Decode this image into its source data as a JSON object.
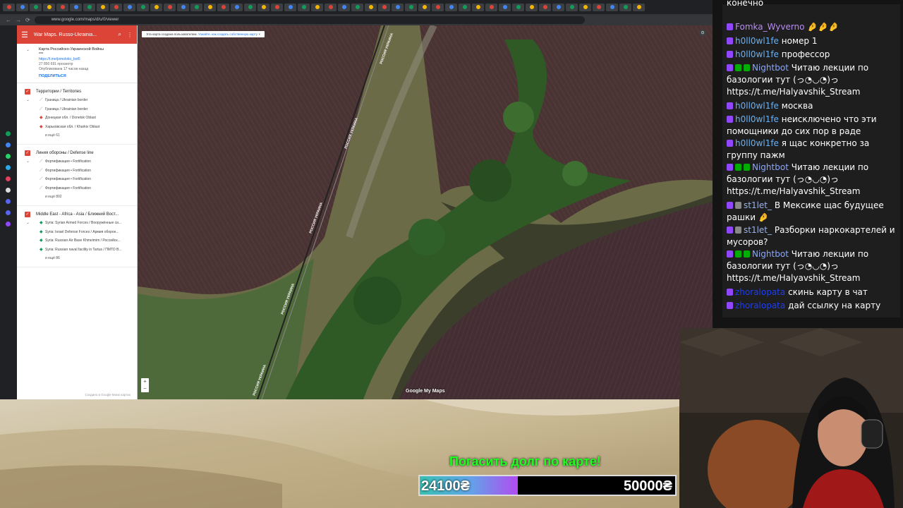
{
  "browser": {
    "url": "www.google.com/maps/d/u/0/viewer",
    "tab_colors": [
      "#db4437",
      "#4285f4",
      "#0f9d58",
      "#f4b400",
      "#db4437",
      "#4285f4",
      "#0f9d58",
      "#f4b400",
      "#db4437",
      "#4285f4",
      "#0f9d58",
      "#f4b400",
      "#db4437",
      "#4285f4",
      "#0f9d58",
      "#f4b400",
      "#db4437",
      "#4285f4",
      "#0f9d58",
      "#f4b400",
      "#db4437",
      "#4285f4",
      "#0f9d58",
      "#f4b400",
      "#db4437",
      "#4285f4",
      "#0f9d58",
      "#f4b400",
      "#db4437",
      "#4285f4",
      "#0f9d58",
      "#f4b400",
      "#db4437",
      "#4285f4",
      "#0f9d58",
      "#f4b400",
      "#db4437",
      "#4285f4",
      "#0f9d58",
      "#f4b400",
      "#db4437",
      "#4285f4",
      "#0f9d58",
      "#f4b400",
      "#db4437",
      "#4285f4",
      "#0f9d58",
      "#f4b400"
    ]
  },
  "sidebar": {
    "title": "War Maps. Russo-Ukrainia...",
    "map_title": "Карта Российско-Украинской Войны",
    "map_title_extra": "***",
    "link": "https://t.me/jomoloko_bot5",
    "views": "27 850 691 просмотр",
    "published": "Опубликована 17 часов назад",
    "share": "ПОДЕЛИТЬСЯ",
    "layers": [
      {
        "name": "Территории / Territories",
        "items": [
          {
            "icon": "line",
            "label": "Граница / Ukrainian border"
          },
          {
            "icon": "line",
            "label": "Граница / Ukrainian border"
          },
          {
            "icon": "poly-red",
            "label": "Донецкая обл. / Donetsk Oblast"
          },
          {
            "icon": "poly-red",
            "label": "Харьковская обл. / Kharkiv Oblast"
          }
        ],
        "more": "и ещё 61"
      },
      {
        "name": "Линия обороны / Defense line",
        "items": [
          {
            "icon": "line",
            "label": "Фортификация • Fortification"
          },
          {
            "icon": "line",
            "label": "Фортификация • Fortification"
          },
          {
            "icon": "line",
            "label": "Фортификация • Fortification"
          },
          {
            "icon": "line",
            "label": "Фортификация • Fortification"
          }
        ],
        "more": "и ещё 802"
      },
      {
        "name": "Middle East - Africa - Asia / Ближний Вост...",
        "items": [
          {
            "icon": "poly-green",
            "label": "Syria: Syrian Armed Forces / Вооружённые си..."
          },
          {
            "icon": "poly-green",
            "label": "Syria: Israel Defense Forces / Армия оборон..."
          },
          {
            "icon": "poly-green",
            "label": "Syria: Russian Air Base Khmeimim / Российск..."
          },
          {
            "icon": "poly-green",
            "label": "Syria: Russian naval facility in Tartus / ПМТО В..."
          }
        ],
        "more": "и ещё 86"
      }
    ],
    "footer": "Создано в Google Моих картах"
  },
  "map": {
    "notice": "Эта карта создана пользователем.",
    "notice_link": "Узнайте, как создать собственную карту",
    "road_label": "РОССИЯ УКРАИНА",
    "attribution": "Google My Maps"
  },
  "chat": {
    "top_fragment": "конечно",
    "messages": [
      {
        "user": "Fomka_Wyverno",
        "color": "#b98cf5",
        "text": "🤌🤌🤌",
        "badges": [
          "#9147ff"
        ]
      },
      {
        "user": "h0ll0wl1fe",
        "color": "#6ab0f3",
        "text": "номер 1",
        "badges": [
          "#9147ff"
        ]
      },
      {
        "user": "h0ll0wl1fe",
        "color": "#6ab0f3",
        "text": "профессор",
        "badges": [
          "#9147ff"
        ]
      },
      {
        "user": "Nightbot",
        "color": "#8aa7ff",
        "text": "Читаю лекции по базологии тут (っ◔◡◔)っ https://t.me/Halyavshik_Stream",
        "badges": [
          "#9147ff",
          "#00ad03",
          "#00ad03"
        ]
      },
      {
        "user": "h0ll0wl1fe",
        "color": "#6ab0f3",
        "text": "москва",
        "badges": [
          "#9147ff"
        ]
      },
      {
        "user": "h0ll0wl1fe",
        "color": "#6ab0f3",
        "text": "неисключено что эти помощники до сих пор в раде",
        "badges": [
          "#9147ff"
        ]
      },
      {
        "user": "h0ll0wl1fe",
        "color": "#6ab0f3",
        "text": "я щас конкретно за группу пажм",
        "badges": [
          "#9147ff"
        ]
      },
      {
        "user": "Nightbot",
        "color": "#8aa7ff",
        "text": "Читаю лекции по базологии тут (っ◔◡◔)っ https://t.me/Halyavshik_Stream",
        "badges": [
          "#9147ff",
          "#00ad03",
          "#00ad03"
        ]
      },
      {
        "user": "st1let_",
        "color": "#9ab2e8",
        "text": "В Мексике щас будущее рашки 🤌",
        "badges": [
          "#9147ff",
          "#888888"
        ]
      },
      {
        "user": "st1let_",
        "color": "#9ab2e8",
        "text": "Разборки наркокартелей и мусоров?",
        "badges": [
          "#9147ff",
          "#888888"
        ]
      },
      {
        "user": "Nightbot",
        "color": "#8aa7ff",
        "text": "Читаю лекции по базологии тут (っ◔◡◔)っ https://t.me/Halyavshik_Stream",
        "badges": [
          "#9147ff",
          "#00ad03",
          "#00ad03"
        ]
      },
      {
        "user": "zhoralopata",
        "color": "#1a3cff",
        "text": "скинь карту в чат",
        "badges": [
          "#9147ff"
        ]
      },
      {
        "user": "zhoralopata",
        "color": "#1a3cff",
        "text": "дай ссылку на карту",
        "badges": [
          "#9147ff"
        ]
      }
    ]
  },
  "donation": {
    "title": "Погасить долг по карте!",
    "current": "24100₴",
    "goal": "50000₴",
    "progress": 0.385
  }
}
